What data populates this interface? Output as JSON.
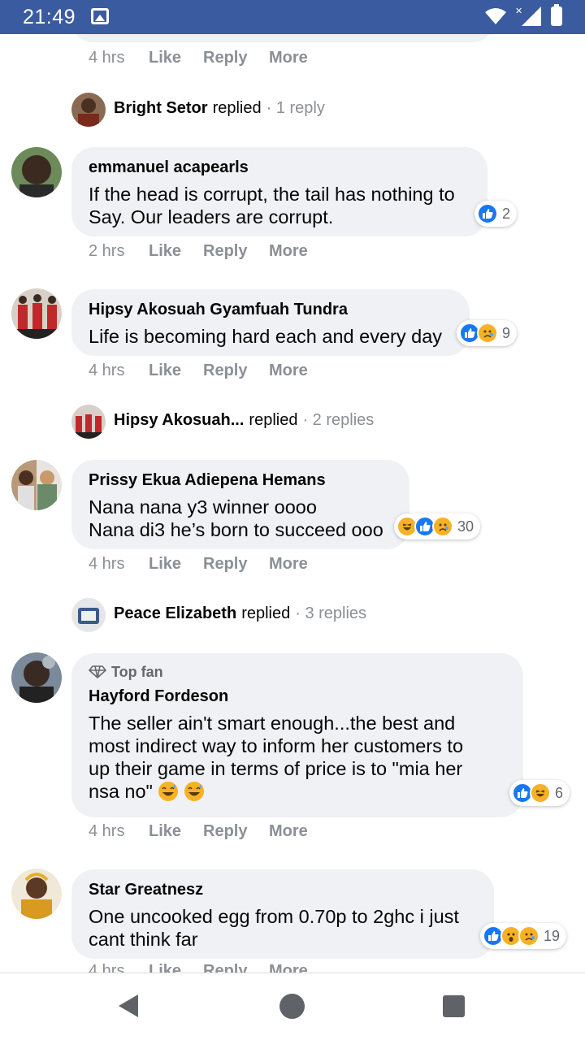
{
  "status_bar": {
    "time": "21:49"
  },
  "actions_labels": {
    "like": "Like",
    "reply": "Reply",
    "more": "More"
  },
  "top_actions": {
    "time": "4 hrs"
  },
  "reply_summary_1": {
    "name": "Bright Setor",
    "verb": "replied",
    "count": "· 1 reply"
  },
  "comments": [
    {
      "name": "emmanuel acapearls",
      "lines": [
        "If the head is corrupt, the tail has nothing to",
        "Say. Our leaders are corrupt."
      ],
      "reaction_count": "2",
      "time": "2 hrs"
    },
    {
      "name": "Hipsy Akosuah Gyamfuah Tundra",
      "lines": [
        "Life is becoming hard each and every day"
      ],
      "reaction_count": "9",
      "time": "4 hrs"
    },
    {
      "name": "Prissy Ekua Adiepena Hemans",
      "lines": [
        "Nana nana y3 winner oooo",
        "Nana di3 he’s born to succeed ooo"
      ],
      "reaction_count": "30",
      "time": "4 hrs"
    },
    {
      "badge": "Top fan",
      "name": "Hayford Fordeson",
      "lines": [
        "The seller ain't smart enough...the best and",
        "most indirect way to inform her customers to",
        "up their game in terms of price is to \"mia her",
        "nsa no\""
      ],
      "reaction_count": "6",
      "time": "4 hrs"
    },
    {
      "name": "Star Greatnesz",
      "lines": [
        "One uncooked egg from 0.70p to 2ghc i just",
        "cant think far"
      ],
      "reaction_count": "19",
      "time": "4 hrs"
    }
  ],
  "reply_summary_2": {
    "name": "Hipsy Akosuah...",
    "verb": "replied",
    "count": "· 2 replies"
  },
  "reply_summary_3": {
    "name": "Peace Elizabeth",
    "verb": "replied",
    "count": "· 3 replies"
  },
  "colors": {
    "status_bar": "#3b5ba0",
    "bubble": "#eff1f4",
    "like_blue": "#1877f2",
    "muted": "#8b8f96"
  },
  "icons": [
    "image-icon",
    "wifi-icon",
    "signal-icon",
    "battery-icon",
    "like-reaction-icon",
    "haha-reaction-icon",
    "sad-reaction-icon",
    "wow-reaction-icon",
    "diamond-icon",
    "back-icon",
    "home-icon",
    "recents-icon"
  ]
}
